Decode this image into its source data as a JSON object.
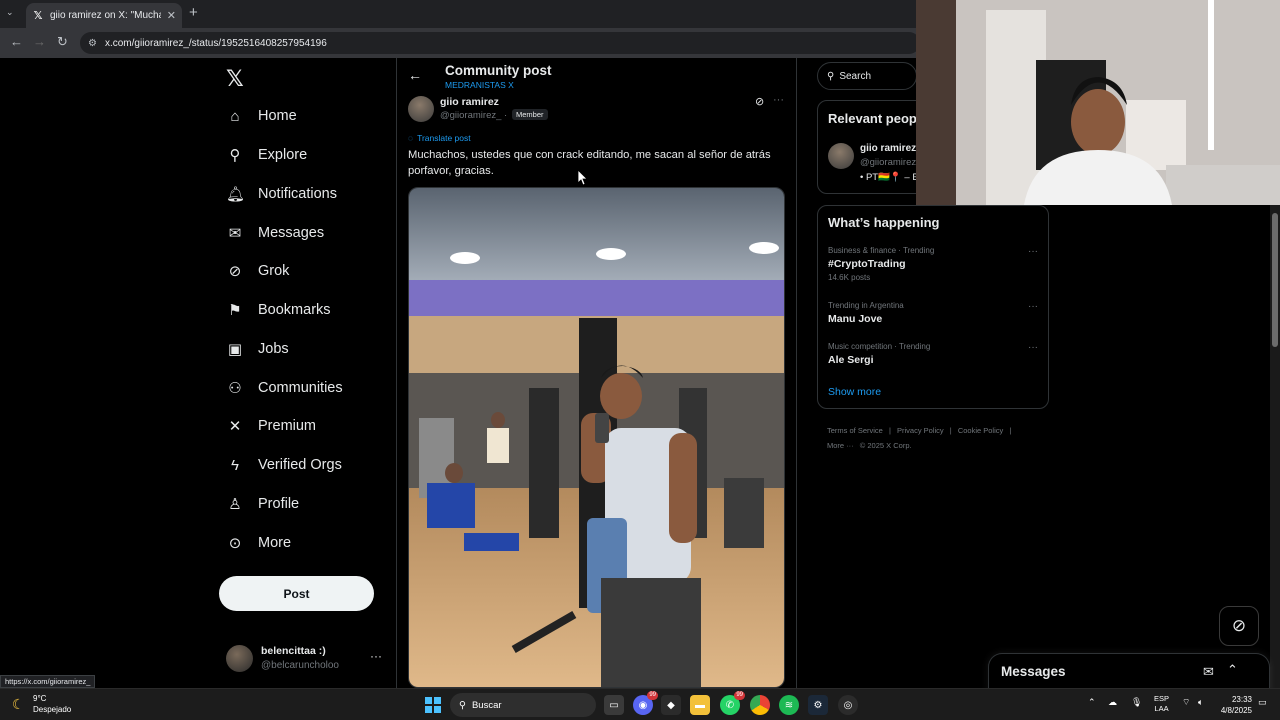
{
  "browser": {
    "tab_title": "giio ramirez on X: \"Muchachos",
    "url": "x.com/giioramirez_/status/1952516408257954196",
    "status_url": "https://x.com/giioramirez_"
  },
  "nav": {
    "items": [
      {
        "label": "Home",
        "icon": "home-icon"
      },
      {
        "label": "Explore",
        "icon": "search-icon"
      },
      {
        "label": "Notifications",
        "icon": "bell-icon"
      },
      {
        "label": "Messages",
        "icon": "envelope-icon"
      },
      {
        "label": "Grok",
        "icon": "grok-icon"
      },
      {
        "label": "Bookmarks",
        "icon": "bookmark-icon"
      },
      {
        "label": "Jobs",
        "icon": "briefcase-icon"
      },
      {
        "label": "Communities",
        "icon": "people-icon"
      },
      {
        "label": "Premium",
        "icon": "x-icon"
      },
      {
        "label": "Verified Orgs",
        "icon": "lightning-icon"
      },
      {
        "label": "Profile",
        "icon": "person-icon"
      },
      {
        "label": "More",
        "icon": "more-circle-icon"
      }
    ],
    "post_button": "Post",
    "account": {
      "name": "belencittaa :)",
      "handle": "@belcaruncholoo"
    }
  },
  "header": {
    "title": "Community post",
    "community": "MEDRANISTAS X"
  },
  "post": {
    "author_name": "giio ramirez",
    "author_handle": "@giioramirez_ ·",
    "badge": "Member",
    "translate_label": "Translate post",
    "text": "Muchachos, ustedes que con crack editando, me sacan al señor de atrás porfavor, gracias."
  },
  "right": {
    "search_placeholder": "Search",
    "relevant": {
      "title": "Relevant peop",
      "name": "giio ramirez",
      "handle": "@giioramirez",
      "bio": "• PT🇧🇴📍 – B"
    },
    "happening": {
      "title": "What’s happening",
      "trends": [
        {
          "meta": "Business & finance · Trending",
          "name": "#CryptoTrading",
          "count": "14.6K posts"
        },
        {
          "meta": "Trending in Argentina",
          "name": "Manu Jove",
          "count": ""
        },
        {
          "meta": "Music competition · Trending",
          "name": "Ale Sergi",
          "count": ""
        }
      ],
      "show_more": "Show more"
    },
    "footer": [
      "Terms of Service",
      "|",
      "Privacy Policy",
      "|",
      "Cookie Policy",
      "|",
      "More ···",
      "© 2025 X Corp."
    ]
  },
  "messages_drawer": {
    "title": "Messages"
  },
  "taskbar": {
    "weather_temp": "9°C",
    "weather_desc": "Despejado",
    "search_label": "Buscar",
    "discord_badge": "99",
    "whatsapp_badge": "99",
    "lang_top": "ESP",
    "lang_bottom": "LAA",
    "time": "23:33",
    "date": "4/8/2025"
  },
  "colors": {
    "accent": "#1d9bf0",
    "background": "#000000",
    "text": "#e7e9ea",
    "muted": "#71767b"
  }
}
